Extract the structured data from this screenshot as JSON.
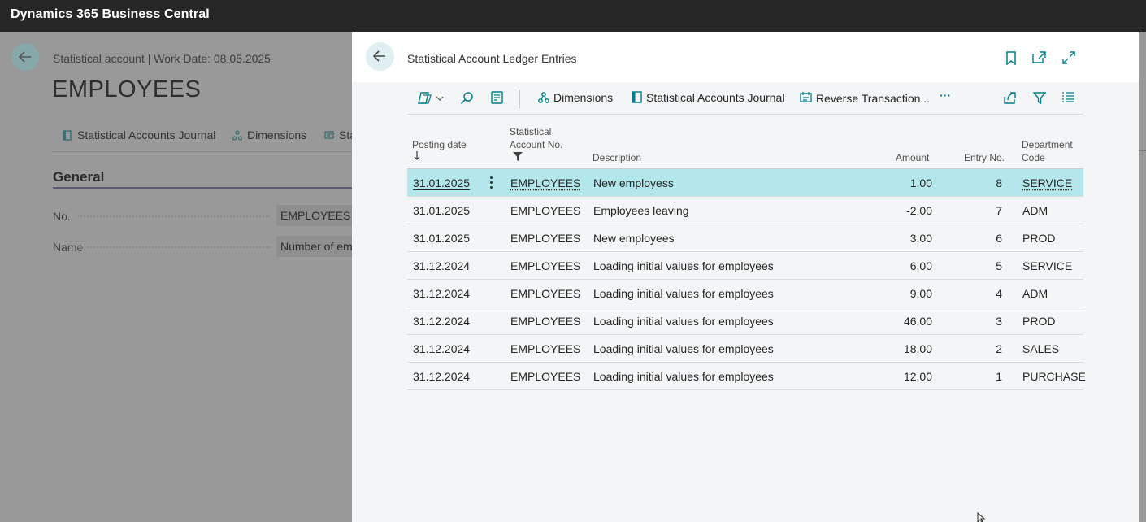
{
  "app": {
    "title": "Dynamics 365 Business Central"
  },
  "background": {
    "breadcrumb": "Statistical account | Work Date: 08.05.2025",
    "title": "EMPLOYEES",
    "actions": [
      {
        "label": "Statistical Accounts Journal",
        "icon": "journal-icon"
      },
      {
        "label": "Dimensions",
        "icon": "dimensions-icon"
      },
      {
        "label": "Sta",
        "icon": "reverse-icon"
      }
    ],
    "section": "General",
    "fields": [
      {
        "label": "No.",
        "value": "EMPLOYEES"
      },
      {
        "label": "Name",
        "value": "Number of em"
      }
    ]
  },
  "panel": {
    "title": "Statistical Account Ledger Entries",
    "header_icons": [
      "bookmark-icon",
      "open-new-window-icon",
      "expand-icon"
    ],
    "toolbar": {
      "dimensions_label": "Dimensions",
      "journal_label": "Statistical Accounts Journal",
      "reverse_label": "Reverse Transaction...",
      "more_label": "···"
    },
    "columns": {
      "posting_date": "Posting date",
      "account_no_line1": "Statistical",
      "account_no_line2": "Account No.",
      "description": "Description",
      "amount": "Amount",
      "entry_no": "Entry No.",
      "dept_line1": "Department",
      "dept_line2": "Code"
    },
    "rows": [
      {
        "date": "31.01.2025",
        "account": "EMPLOYEES",
        "description": "New employess",
        "amount": "1,00",
        "entry": "8",
        "dept": "SERVICE"
      },
      {
        "date": "31.01.2025",
        "account": "EMPLOYEES",
        "description": "Employees leaving",
        "amount": "-2,00",
        "entry": "7",
        "dept": "ADM"
      },
      {
        "date": "31.01.2025",
        "account": "EMPLOYEES",
        "description": "New employees",
        "amount": "3,00",
        "entry": "6",
        "dept": "PROD"
      },
      {
        "date": "31.12.2024",
        "account": "EMPLOYEES",
        "description": "Loading initial values for employees",
        "amount": "6,00",
        "entry": "5",
        "dept": "SERVICE"
      },
      {
        "date": "31.12.2024",
        "account": "EMPLOYEES",
        "description": "Loading initial values for employees",
        "amount": "9,00",
        "entry": "4",
        "dept": "ADM"
      },
      {
        "date": "31.12.2024",
        "account": "EMPLOYEES",
        "description": "Loading initial values for employees",
        "amount": "46,00",
        "entry": "3",
        "dept": "PROD"
      },
      {
        "date": "31.12.2024",
        "account": "EMPLOYEES",
        "description": "Loading initial values for employees",
        "amount": "18,00",
        "entry": "2",
        "dept": "SALES"
      },
      {
        "date": "31.12.2024",
        "account": "EMPLOYEES",
        "description": "Loading initial values for employees",
        "amount": "12,00",
        "entry": "1",
        "dept": "PURCHASE"
      }
    ],
    "colors": {
      "selected_row": "#b3e7ec",
      "accent": "#007f8a"
    }
  }
}
